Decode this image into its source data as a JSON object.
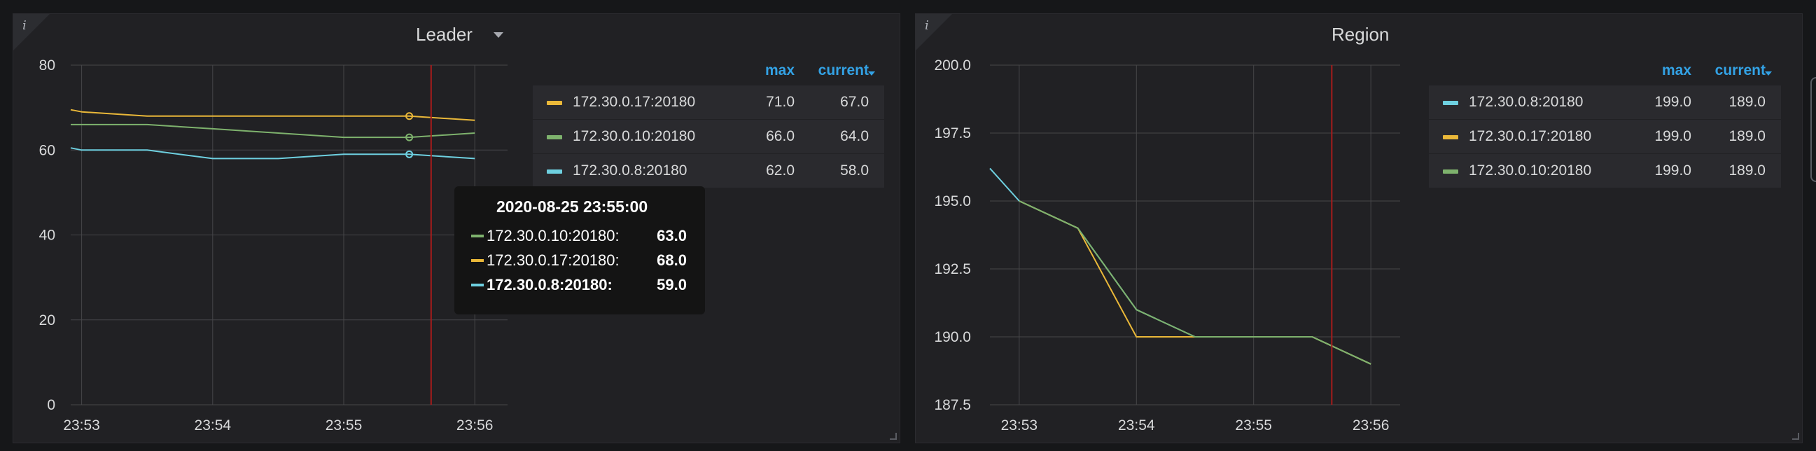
{
  "colors": {
    "green": "#7eb26d",
    "orange": "#eab839",
    "cyan": "#6ed0e0",
    "grid": "#464649",
    "crosshair": "#a61c1c",
    "legend_header": "#33a2e5"
  },
  "leader": {
    "title": "Leader",
    "info_icon": "i",
    "legend": {
      "max_header": "max",
      "current_header": "current",
      "rows": [
        {
          "name": "172.30.0.17:20180",
          "color": "#eab839",
          "max": "71.0",
          "current": "67.0"
        },
        {
          "name": "172.30.0.10:20180",
          "color": "#7eb26d",
          "max": "66.0",
          "current": "64.0"
        },
        {
          "name": "172.30.0.8:20180",
          "color": "#6ed0e0",
          "max": "62.0",
          "current": "58.0"
        }
      ]
    },
    "tooltip": {
      "time": "2020-08-25 23:55:00",
      "rows": [
        {
          "name": "172.30.0.10:20180:",
          "value": "63.0",
          "color": "#7eb26d"
        },
        {
          "name": "172.30.0.17:20180:",
          "value": "68.0",
          "color": "#eab839"
        },
        {
          "name": "172.30.0.8:20180:",
          "value": "59.0",
          "color": "#6ed0e0"
        }
      ]
    }
  },
  "region": {
    "title": "Region",
    "info_icon": "i",
    "legend": {
      "max_header": "max",
      "current_header": "current",
      "rows": [
        {
          "name": "172.30.0.8:20180",
          "color": "#6ed0e0",
          "max": "199.0",
          "current": "189.0"
        },
        {
          "name": "172.30.0.17:20180",
          "color": "#eab839",
          "max": "199.0",
          "current": "189.0"
        },
        {
          "name": "172.30.0.10:20180",
          "color": "#7eb26d",
          "max": "199.0",
          "current": "189.0"
        }
      ]
    }
  },
  "chart_data": [
    {
      "type": "line",
      "title": "Leader",
      "x_ticks": [
        "23:53",
        "23:54",
        "23:55",
        "23:56"
      ],
      "x_range": [
        "23:52:55",
        "23:56:15"
      ],
      "ylim": [
        0,
        80
      ],
      "y_ticks": [
        "0",
        "20",
        "40",
        "60",
        "80"
      ],
      "grid": true,
      "legend_placement": "right",
      "crosshair_x": "23:55:40",
      "series": [
        {
          "name": "172.30.0.17:20180",
          "color": "#eab839",
          "x": [
            "23:52:55",
            "23:53:00",
            "23:53:30",
            "23:54:00",
            "23:54:30",
            "23:55:00",
            "23:55:30",
            "23:56:00"
          ],
          "y": [
            69.5,
            69,
            68,
            68,
            68,
            68,
            68,
            67
          ]
        },
        {
          "name": "172.30.0.10:20180",
          "color": "#7eb26d",
          "x": [
            "23:52:55",
            "23:53:00",
            "23:53:30",
            "23:54:00",
            "23:54:30",
            "23:55:00",
            "23:55:30",
            "23:56:00"
          ],
          "y": [
            66,
            66,
            66,
            65,
            64,
            63,
            63,
            64
          ]
        },
        {
          "name": "172.30.0.8:20180",
          "color": "#6ed0e0",
          "x": [
            "23:52:55",
            "23:53:00",
            "23:53:30",
            "23:54:00",
            "23:54:30",
            "23:55:00",
            "23:55:30",
            "23:56:00"
          ],
          "y": [
            60.5,
            60,
            60,
            58,
            58,
            59,
            59,
            58
          ]
        }
      ],
      "hover_points": [
        {
          "x": "23:55:30",
          "y": 68,
          "color": "#eab839"
        },
        {
          "x": "23:55:30",
          "y": 63,
          "color": "#7eb26d"
        },
        {
          "x": "23:55:30",
          "y": 59,
          "color": "#6ed0e0"
        }
      ]
    },
    {
      "type": "line",
      "title": "Region",
      "x_ticks": [
        "23:53",
        "23:54",
        "23:55",
        "23:56"
      ],
      "x_range": [
        "23:52:45",
        "23:56:15"
      ],
      "ylim": [
        187.5,
        200.0
      ],
      "y_ticks": [
        "187.5",
        "190.0",
        "192.5",
        "195.0",
        "197.5",
        "200.0"
      ],
      "grid": true,
      "legend_placement": "right",
      "crosshair_x": "23:55:40",
      "series": [
        {
          "name": "172.30.0.8:20180",
          "color": "#6ed0e0",
          "x": [
            "23:52:45",
            "23:53:00",
            "23:53:30",
            "23:54:00",
            "23:54:30",
            "23:55:00",
            "23:55:30",
            "23:56:00"
          ],
          "y": [
            196.2,
            195,
            194,
            191,
            190,
            190,
            190,
            189
          ]
        },
        {
          "name": "172.30.0.17:20180",
          "color": "#eab839",
          "x": [
            "23:53:00",
            "23:53:30",
            "23:54:00",
            "23:54:30",
            "23:55:00",
            "23:55:30",
            "23:56:00"
          ],
          "y": [
            195,
            194,
            190,
            190,
            190,
            190,
            189
          ]
        },
        {
          "name": "172.30.0.10:20180",
          "color": "#7eb26d",
          "x": [
            "23:53:00",
            "23:53:30",
            "23:54:00",
            "23:54:30",
            "23:55:00",
            "23:55:30",
            "23:56:00"
          ],
          "y": [
            195,
            194,
            191,
            190,
            190,
            190,
            189
          ]
        }
      ]
    }
  ]
}
